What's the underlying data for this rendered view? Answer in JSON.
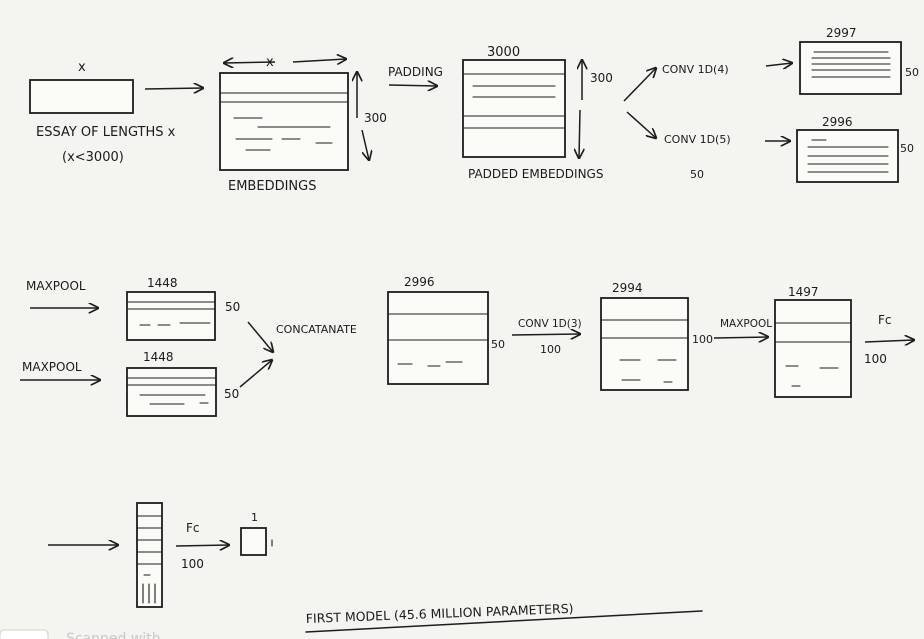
{
  "colors": {
    "paper": "#f4f4f1",
    "ink": "#1d1d1d"
  },
  "row1": {
    "input_x": "x",
    "essay_line1": "ESSAY OF LENGTHS x",
    "essay_line2": "(x<3000)",
    "embed_width": "x",
    "embed_height": "300",
    "embeddings": "EMBEDDINGS",
    "padding": "PADDING",
    "pad_width": "3000",
    "pad_height": "300",
    "padded_embeddings": "PADDED EMBEDDINGS",
    "conv4": "CONV 1D(4)",
    "conv5": "CONV 1D(5)",
    "filters_50": "50",
    "out4_width": "2997",
    "out4_filters": "50",
    "out5_width": "2996",
    "out5_filters": "50"
  },
  "row2": {
    "maxpool_a": "MAXPOOL",
    "maxpool_b": "MAXPOOL",
    "pool_a_width": "1448",
    "pool_a_filters": "50",
    "pool_b_width": "1448",
    "pool_b_filters": "50",
    "concatenate": "CONCATANATE",
    "concat_width": "2996",
    "concat_filters": "50",
    "conv3": "CONV 1D(3)",
    "conv3_filters": "100",
    "conv_out_width": "2994",
    "conv_out_filters": "100",
    "maxpool_c": "MAXPOOL",
    "pool_c_width": "1497",
    "fc_a": "Fc",
    "fc_a_units": "100"
  },
  "row3": {
    "fc_b": "Fc",
    "fc_b_units": "100",
    "out_size": "1"
  },
  "caption": "FIRST MODEL (45.6 MILLION PARAMETERS)",
  "watermark": "Scanned with"
}
